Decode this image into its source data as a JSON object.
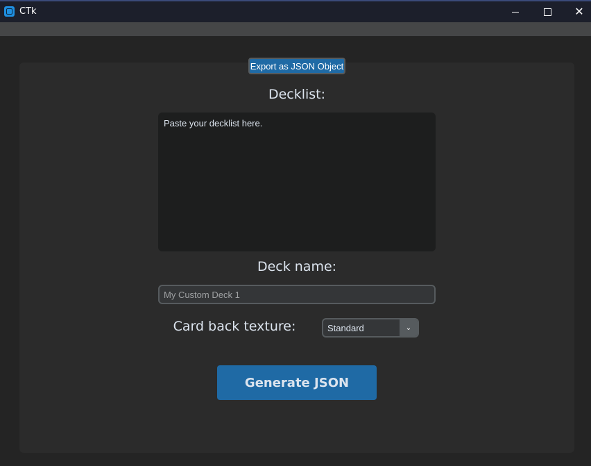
{
  "window": {
    "title": "CTk",
    "minimize_icon": "minimize-icon",
    "maximize_icon": "maximize-icon",
    "close_icon": "close-icon",
    "close_glyph": "✕"
  },
  "toolbar": {
    "export_label": "Export as JSON Object"
  },
  "form": {
    "decklist_label": "Decklist:",
    "decklist_text": "Paste your decklist here.",
    "deckname_label": "Deck name:",
    "deckname_placeholder": "My Custom Deck 1",
    "cardback_label": "Card back texture:",
    "cardback_selected": "Standard",
    "dropdown_glyph": "⌄",
    "generate_label": "Generate JSON"
  },
  "colors": {
    "accent": "#1f6aa5",
    "background": "#242424",
    "panel": "#2b2b2b",
    "titlebar": "#1c1f2b",
    "text": "#dce4ee"
  }
}
